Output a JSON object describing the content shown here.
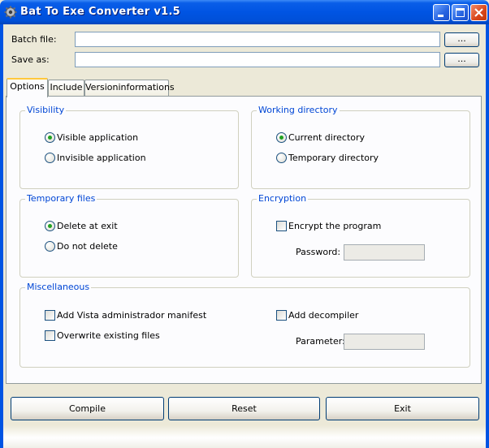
{
  "window": {
    "title": "Bat To Exe Converter v1.5",
    "accent": "#0054e3",
    "controls": {
      "minimize_icon": "minimize-icon",
      "maximize_icon": "maximize-icon",
      "close_icon": "close-icon"
    }
  },
  "fields": {
    "batch_file": {
      "label": "Batch file:",
      "value": "",
      "browse": "..."
    },
    "save_as": {
      "label": "Save as:",
      "value": "",
      "browse": "..."
    }
  },
  "tabs": [
    {
      "label": "Options",
      "active": true
    },
    {
      "label": "Include",
      "active": false
    },
    {
      "label": "Versioninformations",
      "active": false
    }
  ],
  "groups": {
    "visibility": {
      "title": "Visibility",
      "options": [
        {
          "label": "Visible application",
          "selected": true
        },
        {
          "label": "Invisible application",
          "selected": false
        }
      ]
    },
    "working_directory": {
      "title": "Working directory",
      "options": [
        {
          "label": "Current directory",
          "selected": true
        },
        {
          "label": "Temporary directory",
          "selected": false
        }
      ]
    },
    "temporary_files": {
      "title": "Temporary files",
      "options": [
        {
          "label": "Delete at exit",
          "selected": true
        },
        {
          "label": "Do not delete",
          "selected": false
        }
      ]
    },
    "encryption": {
      "title": "Encryption",
      "encrypt_label": "Encrypt the program",
      "encrypt_checked": false,
      "password_label": "Password:",
      "password_value": ""
    },
    "miscellaneous": {
      "title": "Miscellaneous",
      "vista_label": "Add Vista administrador manifest",
      "overwrite_label": "Overwrite existing files",
      "decompiler_label": "Add decompiler",
      "parameter_label": "Parameter:",
      "parameter_value": ""
    }
  },
  "buttons": {
    "compile": "Compile",
    "reset": "Reset",
    "exit": "Exit"
  }
}
